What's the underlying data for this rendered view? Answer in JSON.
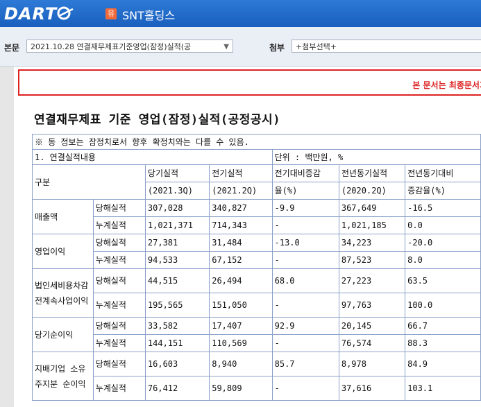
{
  "header": {
    "logo_text": "DART",
    "corp_badge": "유",
    "corp_name": "SNT홀딩스"
  },
  "toolbar": {
    "body_label": "본문",
    "body_select_value": "2021.10.28  연결재무제표기준영업(잠정)실적(공",
    "attach_label": "첨부",
    "attach_select_value": "+첨부선택+"
  },
  "notice": {
    "text": "본 문서는 최종문서가"
  },
  "document": {
    "title": "연결재무제표 기준 영업(잠정)실적(공정공시)",
    "note": "※ 동 정보는 잠정치로서 향후 확정치와는 다를 수 있음.",
    "section": "1. 연결실적내용",
    "unit": "단위 : 백만원, %",
    "headers": {
      "category": "구분",
      "current": "당기실적",
      "current_period": "(2021.3Q)",
      "previous": "전기실적",
      "previous_period": "(2021.2Q)",
      "qoq_1": "전기대비증감",
      "qoq_2": "율(%)",
      "prev_year": "전년동기실적",
      "prev_year_period": "(2020.2Q)",
      "yoy_1": "전년동기대비",
      "yoy_2": "증감율(%)"
    },
    "sub_labels": {
      "quarter": "당해실적",
      "cumulative": "누계실적"
    },
    "rows": [
      {
        "item": "매출액",
        "quarter": [
          "307,028",
          "340,827",
          "-9.9",
          "367,649",
          "-16.5"
        ],
        "cumulative": [
          "1,021,371",
          "714,343",
          "-",
          "1,021,185",
          "0.0"
        ]
      },
      {
        "item": "영업이익",
        "quarter": [
          "27,381",
          "31,484",
          "-13.0",
          "34,223",
          "-20.0"
        ],
        "cumulative": [
          "94,533",
          "67,152",
          "-",
          "87,523",
          "8.0"
        ]
      },
      {
        "item": "법인세비용차감전계속사업이익",
        "quarter": [
          "44,515",
          "26,494",
          "68.0",
          "27,223",
          "63.5"
        ],
        "cumulative": [
          "195,565",
          "151,050",
          "-",
          "97,763",
          "100.0"
        ]
      },
      {
        "item": "당기순이익",
        "quarter": [
          "33,582",
          "17,407",
          "92.9",
          "20,145",
          "66.7"
        ],
        "cumulative": [
          "144,151",
          "110,569",
          "-",
          "76,574",
          "88.3"
        ]
      },
      {
        "item": "지배기업 소유주지분 순이익",
        "quarter": [
          "16,603",
          "8,940",
          "85.7",
          "8,978",
          "84.9"
        ],
        "cumulative": [
          "76,412",
          "59,809",
          "-",
          "37,616",
          "103.1"
        ]
      }
    ]
  }
}
